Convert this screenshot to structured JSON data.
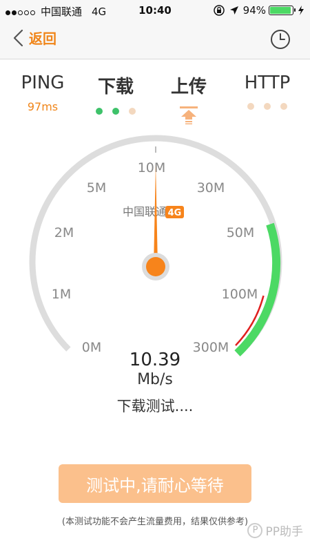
{
  "status_bar": {
    "signal_dots": [
      true,
      true,
      false,
      false,
      false
    ],
    "carrier": "中国联通",
    "network": "4G",
    "time": "10:40",
    "battery": "94%",
    "battery_level": 0.94
  },
  "nav": {
    "back_label": "返回",
    "accent_color": "#f08519"
  },
  "tabs": [
    {
      "name": "PING",
      "value": "97ms"
    },
    {
      "name": "下载",
      "indicator": "dots",
      "dots": [
        "green",
        "green",
        "light"
      ]
    },
    {
      "name": "上传",
      "indicator": "upload-icon"
    },
    {
      "name": "HTTP",
      "indicator": "dots",
      "dots": [
        "light",
        "light",
        "light"
      ]
    }
  ],
  "gauge": {
    "labels": [
      "0M",
      "1M",
      "2M",
      "5M",
      "10M",
      "30M",
      "50M",
      "100M",
      "300M"
    ],
    "carrier_label": "中国联通",
    "network_badge": "4G",
    "needle_label": "10M",
    "colors": {
      "track": "#dddddd",
      "range": "#4cd964",
      "marker": "#e02020",
      "needle": "#f7841b"
    }
  },
  "result": {
    "speed": "10.39",
    "unit": "Mb/s",
    "status": "下载测试...."
  },
  "button_label": "测试中,请耐心等待",
  "footer_note": "(本测试功能不会产生流量费用，结果仅供参考)",
  "watermark": {
    "badge": "P",
    "text": "PP助手"
  }
}
